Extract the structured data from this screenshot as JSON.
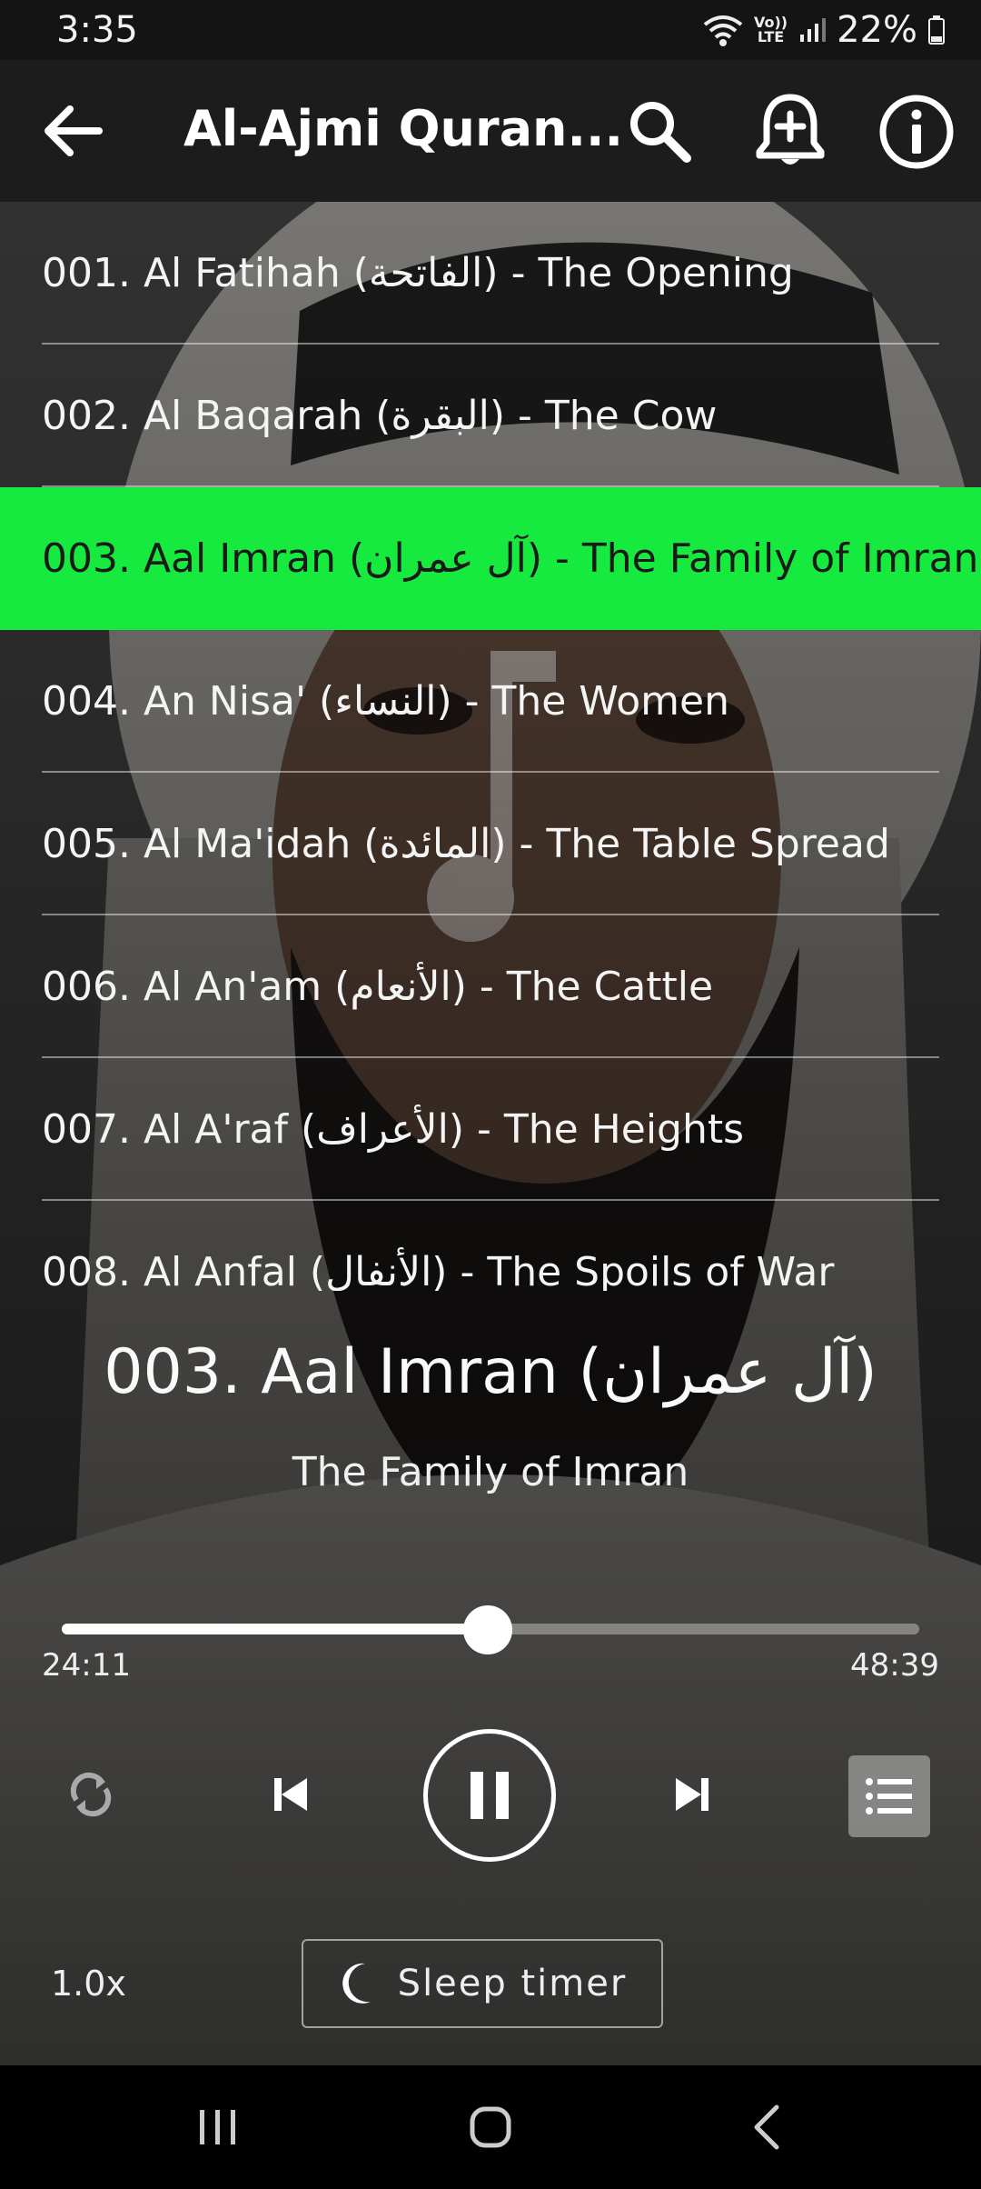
{
  "status_bar": {
    "time": "3:35",
    "network": "LTE",
    "network_top": "Vo))",
    "battery": "22%"
  },
  "app_bar": {
    "title": "Al-Ajmi Quran..."
  },
  "list": {
    "items": [
      {
        "label": "001. Al Fatihah (الفاتحة) - The Opening",
        "active": false
      },
      {
        "label": "002. Al Baqarah (البقرة) - The Cow",
        "active": false
      },
      {
        "label": "003. Aal Imran (آل عمران) - The Family of Imran",
        "active": true
      },
      {
        "label": "004. An Nisa' (النساء) - The Women",
        "active": false
      },
      {
        "label": "005. Al Ma'idah (المائدة) - The Table Spread",
        "active": false
      },
      {
        "label": "006. Al An'am (الأنعام) - The Cattle",
        "active": false
      },
      {
        "label": "007. Al A'raf (الأعراف) - The Heights",
        "active": false
      },
      {
        "label": "008. Al Anfal (الأنفال) - The Spoils of War",
        "active": false
      }
    ]
  },
  "now_playing": {
    "title": "003. Aal Imran (آل عمران)",
    "subtitle": "The Family of Imran"
  },
  "progress": {
    "current": "24:11",
    "total": "48:39",
    "fraction": 0.497
  },
  "controls": {
    "speed": "1.0x",
    "sleep_label": "Sleep timer"
  },
  "colors": {
    "accent": "#17ea3f",
    "appbar": "#1c1c1c"
  }
}
